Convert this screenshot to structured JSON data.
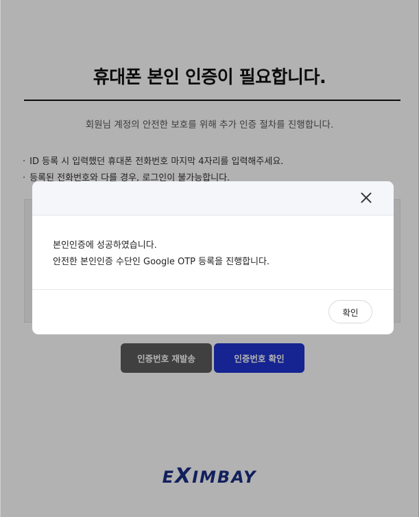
{
  "page": {
    "title": "휴대폰 본인 인증이 필요합니다.",
    "subtitle": "회원님 계정의 안전한 보호를 위해 추가 인증 절차를 진행합니다.",
    "bullets": [
      "ID 등록 시 입력했던 휴대폰 전화번호 마지막 4자리를 입력해주세요.",
      "등록된 전화번호와 다를 경우, 로그인이 불가능합니다."
    ],
    "resend_button": "인증번호 재발송",
    "verify_button": "인증번호 확인",
    "logo": {
      "e": "E",
      "x": "X",
      "rest": "IMBAY",
      "color": "#1c2f86"
    }
  },
  "modal": {
    "close_icon": "close-icon",
    "line1": "본인인증에 성공하였습니다.",
    "line2": "안전한 본인인증 수단인 Google OTP 등록을 진행합니다.",
    "confirm_button": "확인"
  },
  "colors": {
    "primary": "#1f34cf",
    "secondary": "#5c5c5c",
    "overlay": "rgba(0,0,0,0.30)"
  }
}
